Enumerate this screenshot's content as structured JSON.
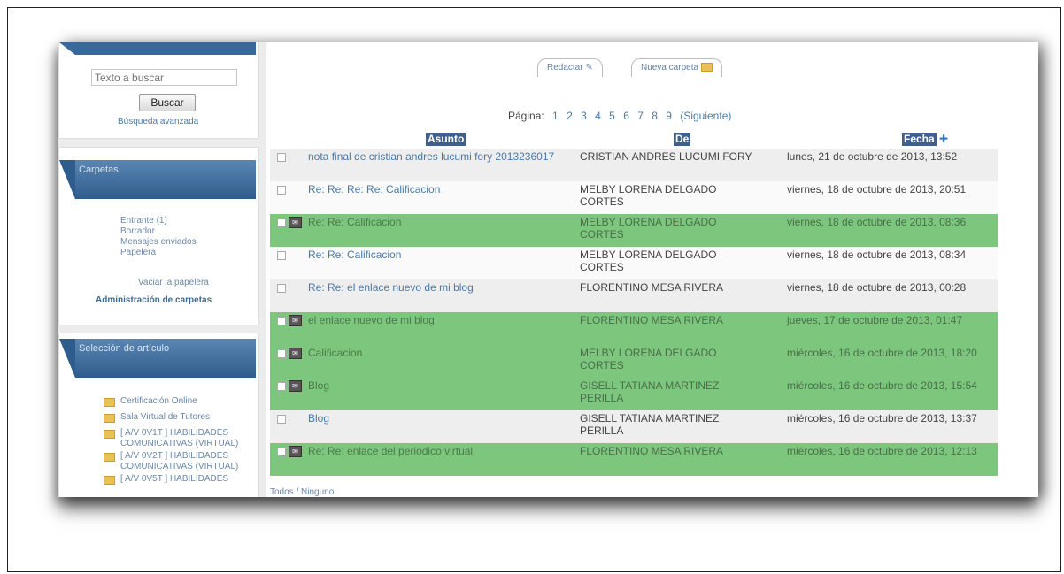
{
  "search": {
    "placeholder": "Texto a buscar",
    "button": "Buscar",
    "advanced": "Búsqueda avanzada"
  },
  "folders_block": {
    "title": "Carpetas",
    "items": [
      "Entrante (1)",
      "Borrador",
      "Mensajes enviados",
      "Papelera"
    ],
    "empty_trash": "Vaciar la papelera",
    "manage": "Administración de carpetas"
  },
  "course_block": {
    "title": "Selección de artículo",
    "items": [
      "Certificación Online",
      "Sala Virtual de Tutores",
      "[ A/V 0V1T ] HABILIDADES COMUNICATIVAS (VIRTUAL)",
      "[ A/V 0V2T ] HABILIDADES COMUNICATIVAS (VIRTUAL)",
      "[ A/V 0V5T ] HABILIDADES"
    ]
  },
  "toolbar": {
    "compose": "Redactar",
    "new_folder": "Nueva carpeta"
  },
  "pagination": {
    "label": "Página:",
    "pages": [
      "1",
      "2",
      "3",
      "4",
      "5",
      "6",
      "7",
      "8",
      "9"
    ],
    "next": "(Siguiente)"
  },
  "columns": {
    "subject": "Asunto",
    "from": "De",
    "date": "Fecha"
  },
  "messages": [
    {
      "subject": "nota final de cristian andres lucumi fory 2013236017",
      "from": "CRISTIAN ANDRES LUCUMI FORY",
      "date": "lunes, 21 de octubre de 2013, 13:52",
      "status": "read"
    },
    {
      "subject": "Re: Re: Re: Re: Calificacion",
      "from": "MELBY LORENA DELGADO CORTES",
      "date": "viernes, 18 de octubre de 2013, 20:51",
      "status": "read"
    },
    {
      "subject": "Re: Re: Calificacion",
      "from": "MELBY LORENA DELGADO CORTES",
      "date": "viernes, 18 de octubre de 2013, 08:36",
      "status": "unread"
    },
    {
      "subject": "Re: Re: Calificacion",
      "from": "MELBY LORENA DELGADO CORTES",
      "date": "viernes, 18 de octubre de 2013, 08:34",
      "status": "read"
    },
    {
      "subject": "Re: Re: el enlace nuevo de mi blog",
      "from": "FLORENTINO MESA RIVERA",
      "date": "viernes, 18 de octubre de 2013, 00:28",
      "status": "read"
    },
    {
      "subject": "el enlace nuevo de mi blog",
      "from": "FLORENTINO MESA RIVERA",
      "date": "jueves, 17 de octubre de 2013, 01:47",
      "status": "unread"
    },
    {
      "subject": "Calificacion",
      "from": "MELBY LORENA DELGADO CORTES",
      "date": "miércoles, 16 de octubre de 2013, 18:20",
      "status": "unread"
    },
    {
      "subject": "Blog",
      "from": "GISELL TATIANA MARTINEZ PERILLA",
      "date": "miércoles, 16 de octubre de 2013, 15:54",
      "status": "unread"
    },
    {
      "subject": "Blog",
      "from": "GISELL TATIANA MARTINEZ PERILLA",
      "date": "miércoles, 16 de octubre de 2013, 13:37",
      "status": "read"
    },
    {
      "subject": "Re: Re: enlace del periodico virtual",
      "from": "FLORENTINO MESA RIVERA",
      "date": "miércoles, 16 de octubre de 2013, 12:13",
      "status": "unread"
    }
  ],
  "footer": "Todos / Ninguno",
  "colors": {
    "unread_row": "#7dc67d",
    "header_blue": "#3f5f8f"
  }
}
